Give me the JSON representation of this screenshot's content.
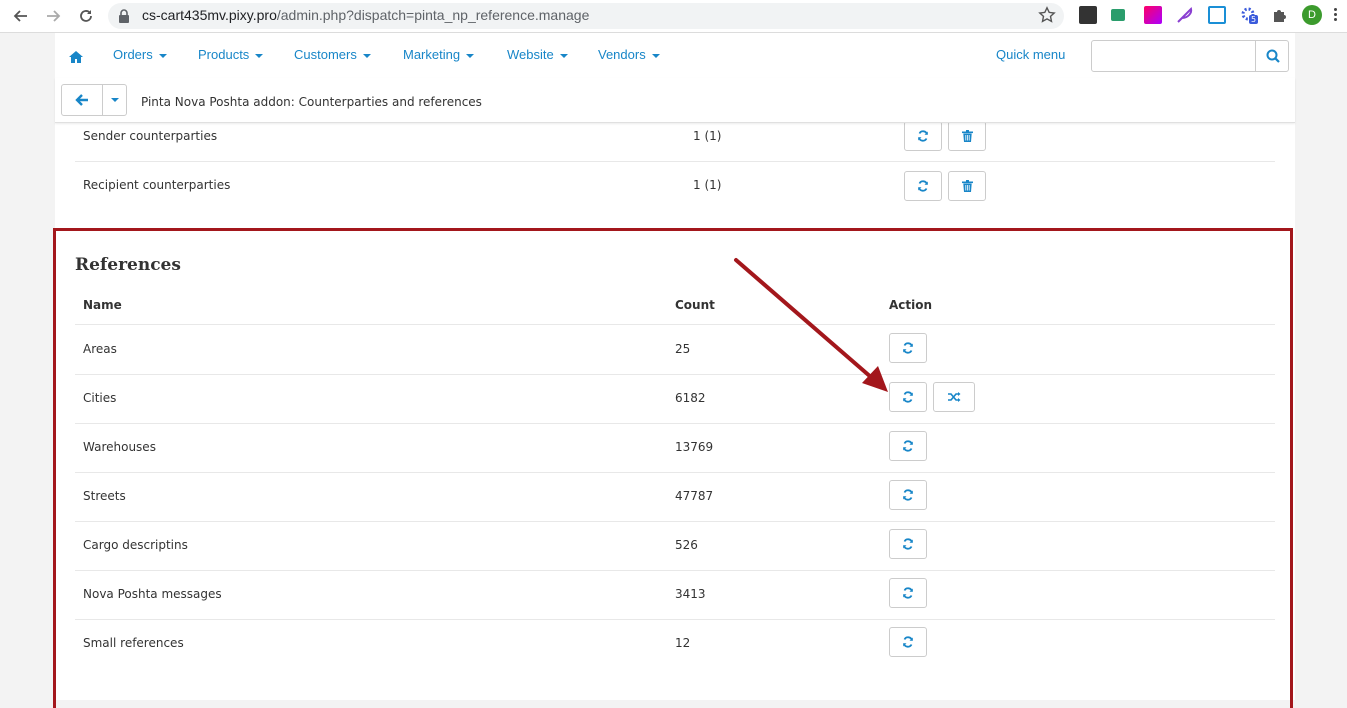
{
  "browser": {
    "url_host": "cs-cart435mv.pixy.pro",
    "url_path": "/admin.php?dispatch=pinta_np_reference.manage",
    "avatar_letter": "D",
    "extension_badge": "5"
  },
  "nav": {
    "items": [
      {
        "label": "Orders"
      },
      {
        "label": "Products"
      },
      {
        "label": "Customers"
      },
      {
        "label": "Marketing"
      },
      {
        "label": "Website"
      },
      {
        "label": "Vendors"
      }
    ],
    "quick_menu": "Quick menu",
    "search_placeholder": ""
  },
  "toolbar": {
    "title": "Pinta Nova Poshta addon: Counterparties and references"
  },
  "counterparties": [
    {
      "name": "Sender counterparties",
      "count": "1 (1)"
    },
    {
      "name": "Recipient counterparties",
      "count": "1 (1)"
    }
  ],
  "references": {
    "title": "References",
    "headers": {
      "name": "Name",
      "count": "Count",
      "action": "Action"
    },
    "rows": [
      {
        "name": "Areas",
        "count": "25"
      },
      {
        "name": "Cities",
        "count": "6182"
      },
      {
        "name": "Warehouses",
        "count": "13769"
      },
      {
        "name": "Streets",
        "count": "47787"
      },
      {
        "name": "Cargo descriptins",
        "count": "526"
      },
      {
        "name": "Nova Poshta messages",
        "count": "3413"
      },
      {
        "name": "Small references",
        "count": "12"
      }
    ]
  },
  "colors": {
    "accent": "#1886c8",
    "highlight": "#a3171c"
  }
}
